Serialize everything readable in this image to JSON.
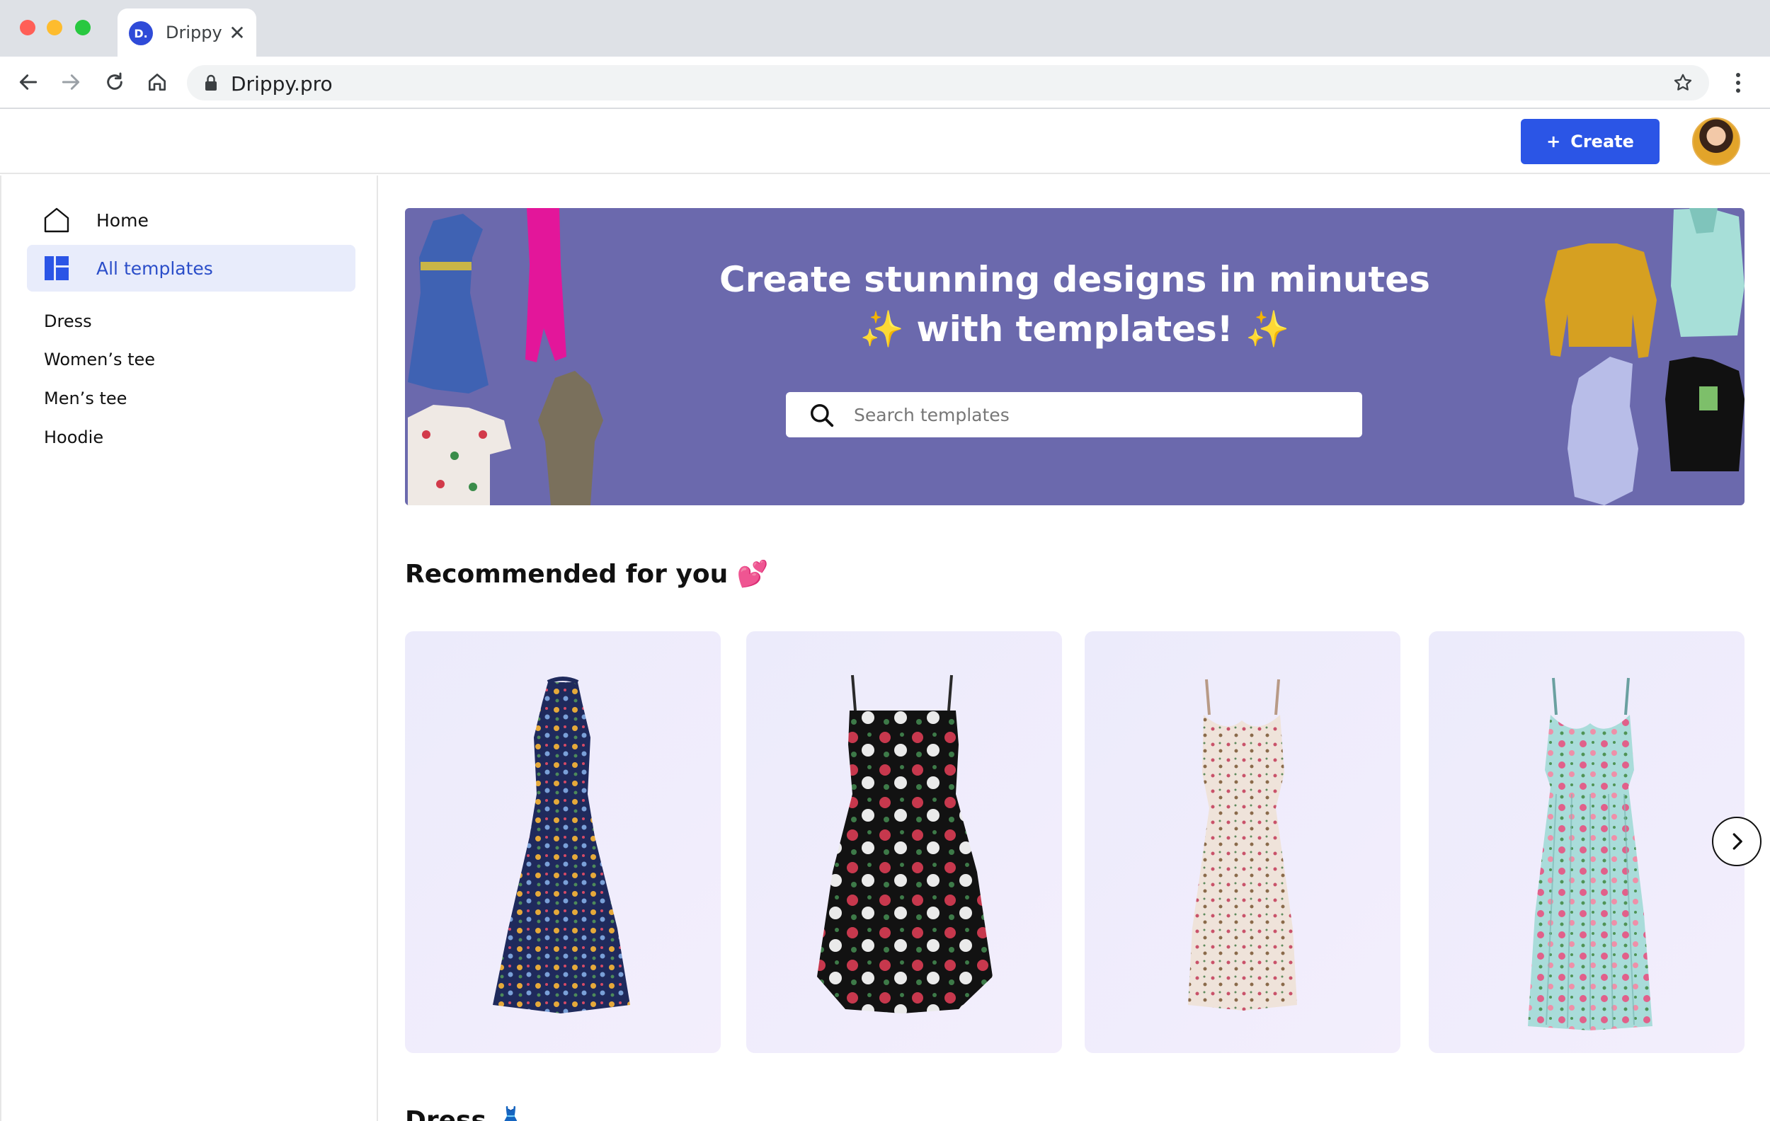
{
  "browser": {
    "tab": {
      "favicon_letter": "D.",
      "title": "Drippy",
      "close_glyph": "✕"
    },
    "url": "Drippy.pro"
  },
  "header": {
    "create_label": "Create",
    "create_glyph": "+"
  },
  "sidebar": {
    "nav": [
      {
        "label": "Home",
        "icon": "home-icon",
        "active": false
      },
      {
        "label": "All templates",
        "icon": "templates-grid-icon",
        "active": true
      }
    ],
    "categories": [
      "Dress",
      "Women’s tee",
      "Men’s tee",
      "Hoodie"
    ]
  },
  "hero": {
    "title_line1": "Create stunning designs in minutes",
    "title_line2": "✨ with templates! ✨",
    "search_placeholder": "Search templates",
    "background_color": "#6b69ad"
  },
  "recommended": {
    "title": "Recommended for you 💕",
    "items": [
      {
        "name": "navy floral halter dress"
      },
      {
        "name": "black rose bubble dress"
      },
      {
        "name": "cream ditsy floral slip dress"
      },
      {
        "name": "mint rose pleated dress"
      }
    ]
  },
  "next_section_title": "Dress 👗",
  "colors": {
    "accent": "#2b55e6",
    "active_nav_bg": "#e8ecfb",
    "active_nav_text": "#2b4ec9"
  }
}
